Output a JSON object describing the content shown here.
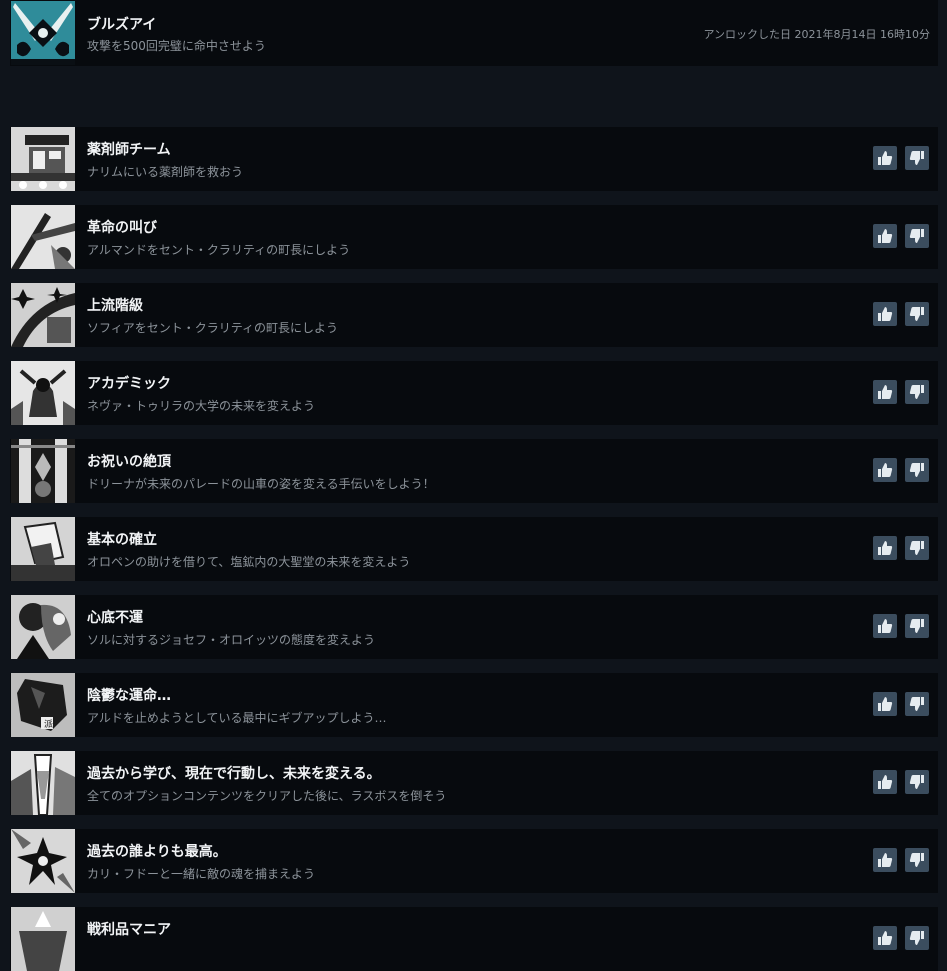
{
  "unlocked": {
    "title": "ブルズアイ",
    "description": "攻撃を500回完璧に命中させよう",
    "unlock_date": "アンロックした日 2021年8月14日 16時10分"
  },
  "locked": [
    {
      "title": "薬剤師チーム",
      "description": "ナリムにいる薬剤師を救おう"
    },
    {
      "title": "革命の叫び",
      "description": "アルマンドをセント・クラリティの町長にしよう"
    },
    {
      "title": "上流階級",
      "description": "ソフィアをセント・クラリティの町長にしよう"
    },
    {
      "title": "アカデミック",
      "description": "ネヴァ・トゥリラの大学の未来を変えよう"
    },
    {
      "title": "お祝いの絶頂",
      "description": "ドリーナが未来のパレードの山車の姿を変える手伝いをしよう！"
    },
    {
      "title": "基本の確立",
      "description": "オロペンの助けを借りて、塩鉱内の大聖堂の未来を変えよう"
    },
    {
      "title": "心底不運",
      "description": "ソルに対するジョセフ・オロイッツの態度を変えよう"
    },
    {
      "title": "陰鬱な運命…",
      "description": "アルドを止めようとしている最中にギブアップしよう…"
    },
    {
      "title": "過去から学び、現在で行動し、未来を変える。",
      "description": "全てのオプションコンテンツをクリアした後に、ラスボスを倒そう"
    },
    {
      "title": "過去の誰よりも最高。",
      "description": "カリ・フドーと一緒に敵の魂を捕まえよう"
    },
    {
      "title": "戦利品マニア",
      "description": ""
    }
  ],
  "icons": {
    "thumbs_up": "thumbs-up-icon",
    "thumbs_down": "thumbs-down-icon"
  },
  "colors": {
    "background": "#0f141b",
    "row": "#070a0e",
    "vote_button": "#3b4d5e",
    "unlocked_icon": "#2f8c9a"
  }
}
